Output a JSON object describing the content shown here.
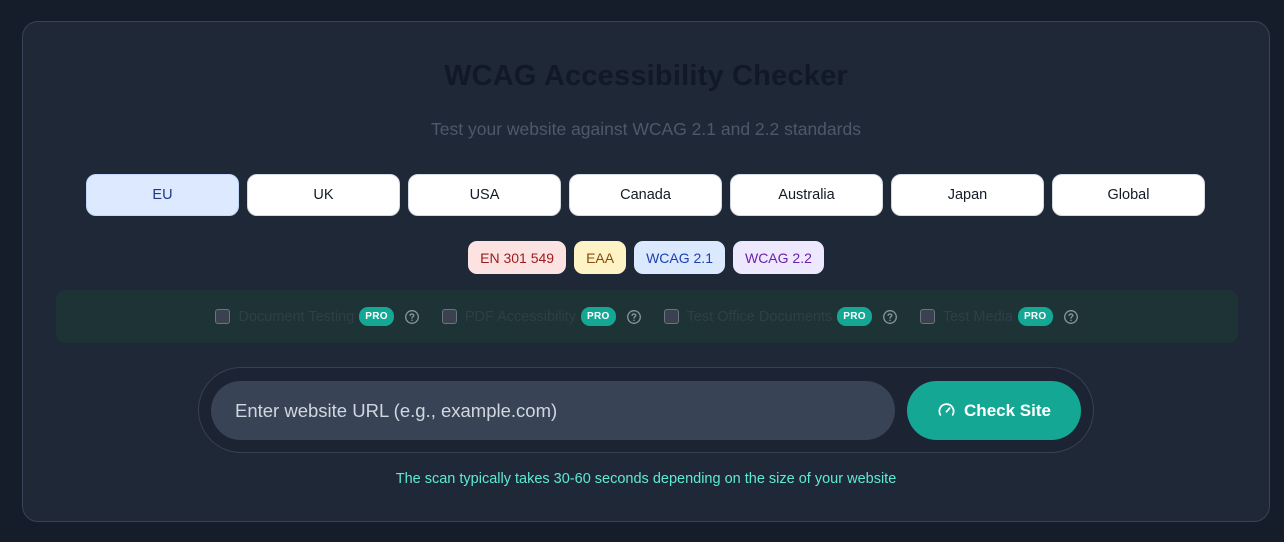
{
  "header": {
    "title": "WCAG Accessibility Checker",
    "subtitle": "Test your website against WCAG 2.1 and 2.2 standards"
  },
  "regions": {
    "selected": "EU",
    "items": [
      {
        "label": "EU"
      },
      {
        "label": "UK"
      },
      {
        "label": "USA"
      },
      {
        "label": "Canada"
      },
      {
        "label": "Australia"
      },
      {
        "label": "Japan"
      },
      {
        "label": "Global"
      }
    ]
  },
  "standards": [
    {
      "label": "EN 301 549",
      "bg": "#fde2e2",
      "fg": "#9b1c1c"
    },
    {
      "label": "EAA",
      "bg": "#fdf3c4",
      "fg": "#8a4b0f"
    },
    {
      "label": "WCAG 2.1",
      "bg": "#dbe9fe",
      "fg": "#1e40af"
    },
    {
      "label": "WCAG 2.2",
      "bg": "#ede8fe",
      "fg": "#6b21a8"
    }
  ],
  "options": [
    {
      "label": "Document Testing",
      "badge": "PRO",
      "checked": false
    },
    {
      "label": "PDF Accessibility",
      "badge": "PRO",
      "checked": false
    },
    {
      "label": "Test Office Documents",
      "badge": "PRO",
      "checked": false
    },
    {
      "label": "Test Media",
      "badge": "PRO",
      "checked": false
    }
  ],
  "search": {
    "placeholder": "Enter website URL (e.g., example.com)",
    "value": "",
    "button_label": "Check Site"
  },
  "note": "The scan typically takes 30-60 seconds depending on the size of your website",
  "colors": {
    "accent": "#14a894",
    "note_text": "#5eead4",
    "background": "#151c2a",
    "card": "#1f2837"
  }
}
